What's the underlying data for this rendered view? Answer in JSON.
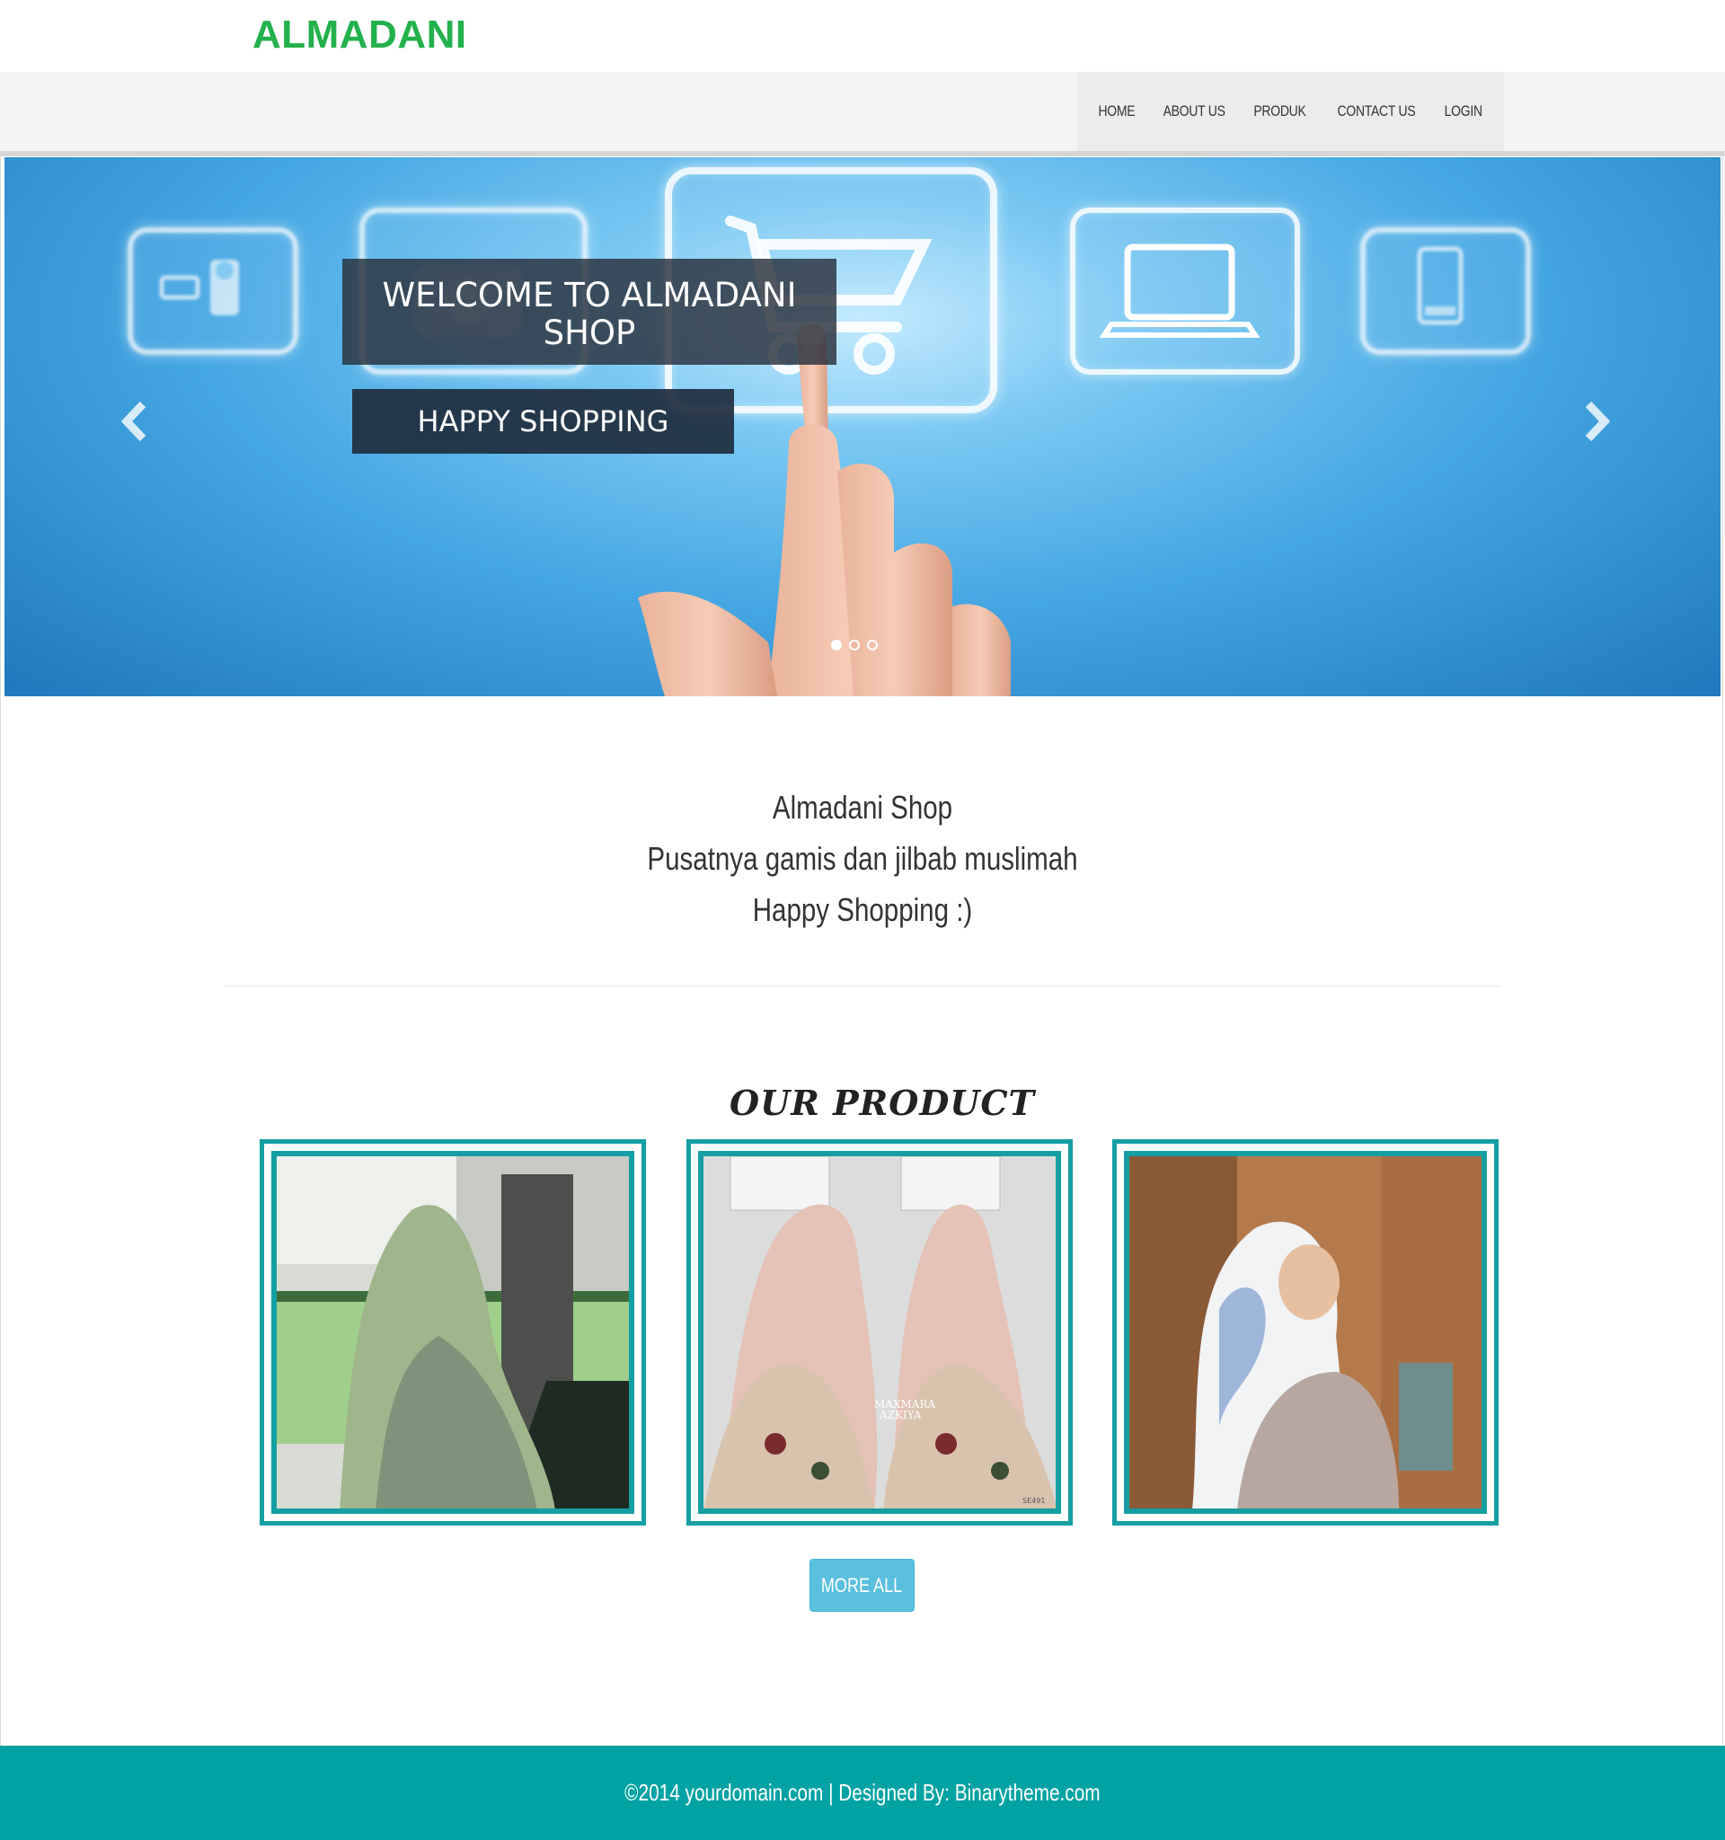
{
  "brand": {
    "logo": "ALMADANI",
    "logo_color": "#22b14c"
  },
  "nav": {
    "items": [
      {
        "label": "HOME"
      },
      {
        "label": "ABOUT US"
      },
      {
        "label": "PRODUK"
      },
      {
        "label": "CONTACT US"
      },
      {
        "label": "LOGIN"
      }
    ]
  },
  "slider": {
    "caption_title": "WELCOME TO ALMADANI SHOP",
    "caption_subtitle": "HAPPY SHOPPING",
    "prev_icon": "chevron-left-icon",
    "next_icon": "chevron-right-icon",
    "slide_count": 3,
    "active_slide": 1
  },
  "intro": {
    "lines": [
      "Almadani Shop",
      "Pusatnya gamis dan jilbab muslimah",
      "Happy Shopping :)"
    ]
  },
  "products": {
    "title": "OUR PRODUCT",
    "more_label": "MORE ALL",
    "frame_color": "#159fa3",
    "image_badge_text": [
      "MAXMARA",
      "AZKIYA",
      "SE491"
    ]
  },
  "footer": {
    "text": "©2014 yourdomain.com | Designed By: Binarytheme.com",
    "background": "#00a2a3"
  }
}
